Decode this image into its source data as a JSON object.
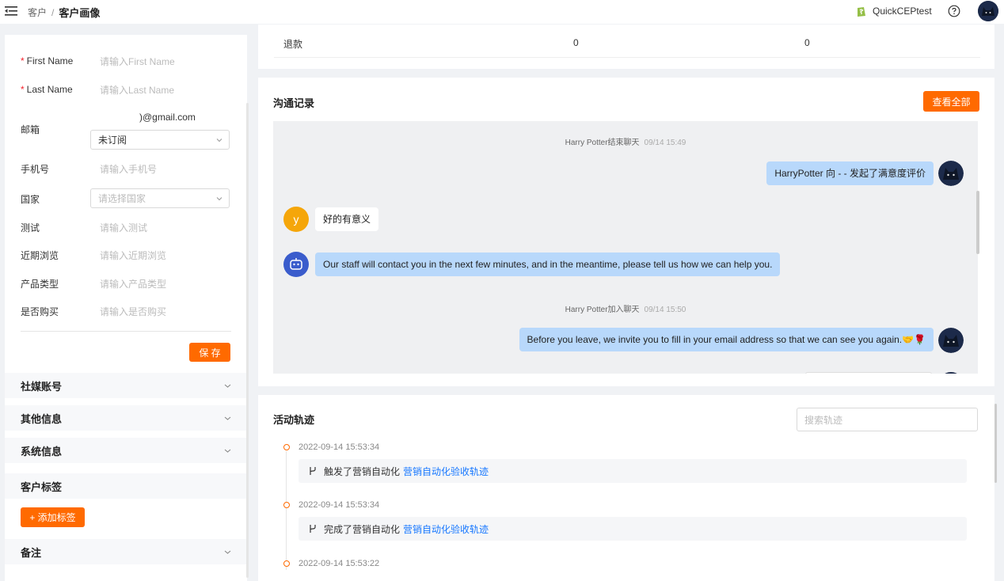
{
  "breadcrumb": {
    "parent": "客户",
    "separator": "/",
    "current": "客户画像"
  },
  "header": {
    "shop_name": "QuickCEPtest"
  },
  "form": {
    "first_name": {
      "label": "First Name",
      "placeholder": "请输入First Name"
    },
    "last_name": {
      "label": "Last Name",
      "placeholder": "请输入Last Name"
    },
    "email": {
      "label": "邮箱",
      "value": ")@gmail.com",
      "subscription": "未订阅"
    },
    "phone": {
      "label": "手机号",
      "placeholder": "请输入手机号"
    },
    "country": {
      "label": "国家",
      "placeholder": "请选择国家"
    },
    "test": {
      "label": "测试",
      "placeholder": "请输入测试"
    },
    "recent_browse": {
      "label": "近期浏览",
      "placeholder": "请输入近期浏览"
    },
    "product_type": {
      "label": "产品类型",
      "placeholder": "请输入产品类型"
    },
    "purchased": {
      "label": "是否购买",
      "placeholder": "请输入是否购买"
    },
    "save_label": "保 存"
  },
  "sections": {
    "social": "社媒账号",
    "other": "其他信息",
    "system": "系统信息",
    "tags": "客户标签",
    "add_tag": "+ 添加标签",
    "notes": "备注"
  },
  "refund_row": {
    "label": "退款",
    "value1": "0",
    "value2": "0"
  },
  "chat": {
    "title": "沟通记录",
    "view_all": "查看全部",
    "messages": [
      {
        "type": "system",
        "text": "Harry Potter结束聊天",
        "time": "09/14 15:49"
      },
      {
        "type": "agent",
        "text": "HarryPotter 向 - - 发起了满意度评价"
      },
      {
        "type": "customer",
        "avatar_letter": "y",
        "text": "好的有意义"
      },
      {
        "type": "bot",
        "text": "Our staff will contact you in the next few minutes, and in the meantime, please tell us how we can help you."
      },
      {
        "type": "system",
        "text": "Harry Potter加入聊天",
        "time": "09/14 15:50"
      },
      {
        "type": "agent",
        "text": "Before you leave, we invite you to fill in your email address so that we can see you again.🤝🌹"
      }
    ]
  },
  "activity": {
    "title": "活动轨迹",
    "search_placeholder": "搜索轨迹",
    "items": [
      {
        "time": "2022-09-14 15:53:34",
        "action": "触发了营销自动化",
        "link": "营销自动化验收轨迹"
      },
      {
        "time": "2022-09-14 15:53:34",
        "action": "完成了营销自动化",
        "link": "营销自动化验收轨迹"
      },
      {
        "time": "2022-09-14 15:53:22"
      }
    ]
  },
  "colors": {
    "accent": "#ff6a00",
    "link": "#1677ff",
    "bubble": "#b8d8fb",
    "bot": "#3a5ccc",
    "customer_avatar": "#f5a60a"
  }
}
